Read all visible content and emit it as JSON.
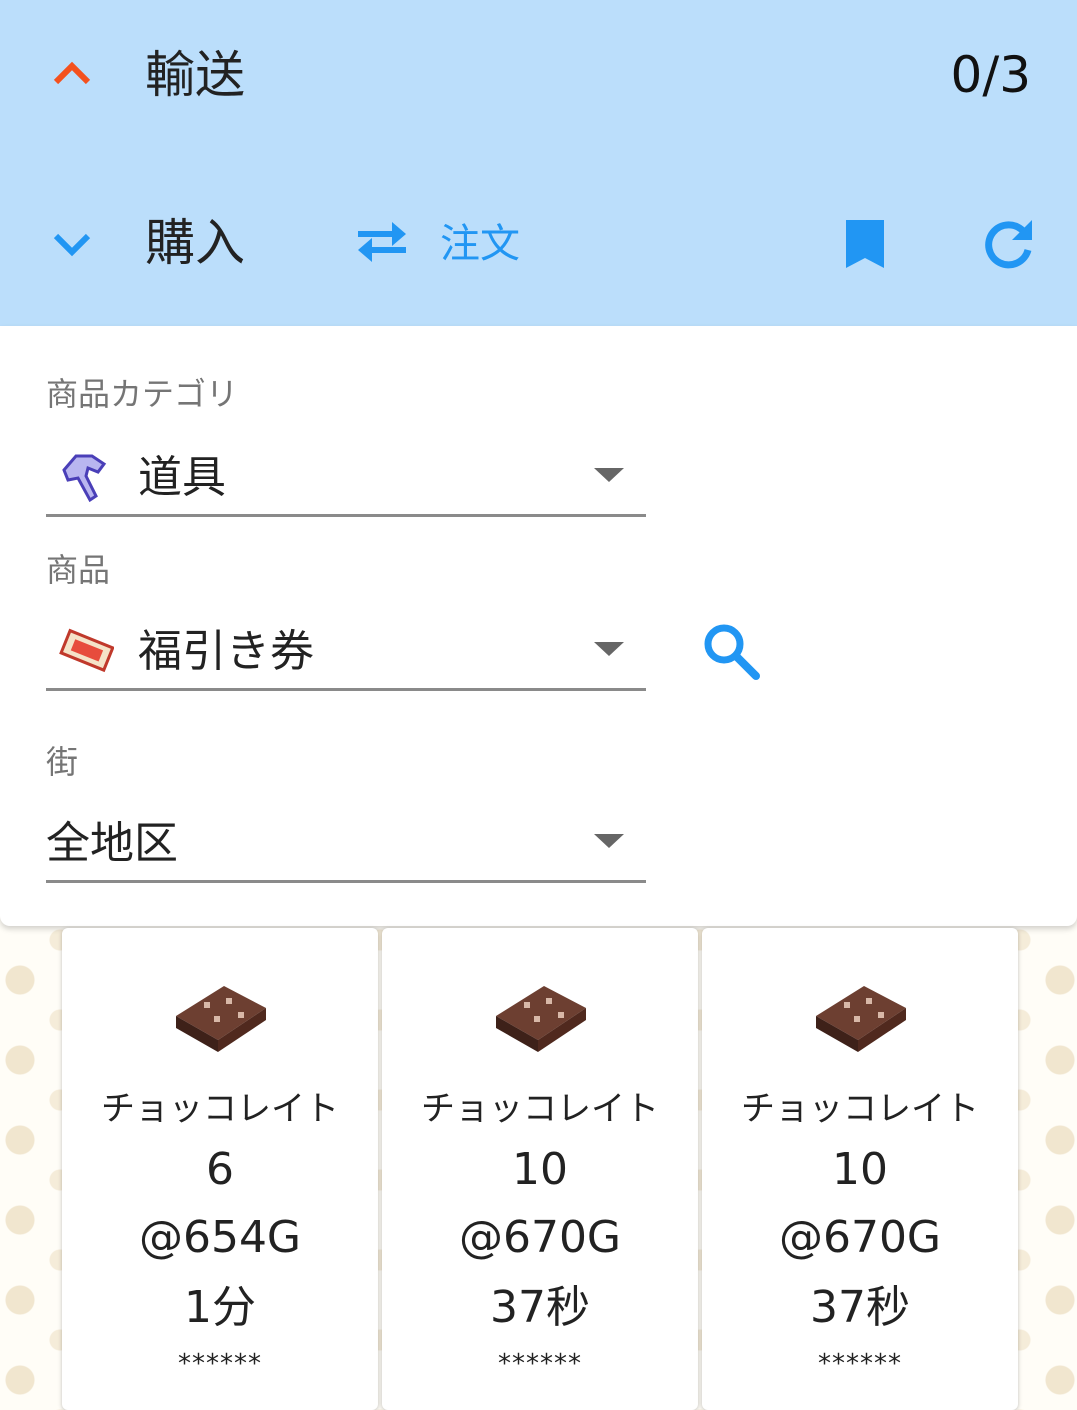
{
  "header": {
    "transport_label": "輸送",
    "transport_count": "0/3",
    "purchase_label": "購入",
    "order_label": "注文",
    "colors": {
      "background": "#bbdefb",
      "accent": "#2196f3",
      "chevron_up": "#f4511e"
    }
  },
  "filters": {
    "category": {
      "label": "商品カテゴリ",
      "value": "道具",
      "icon": "tool-icon"
    },
    "item": {
      "label": "商品",
      "value": "福引き券",
      "icon": "lottery-ticket-icon"
    },
    "town": {
      "label": "街",
      "value": "全地区"
    }
  },
  "listings": [
    {
      "name": "チョッコレイト",
      "quantity": "6",
      "price": "@654G",
      "time": "1分",
      "stars": "******",
      "icon": "chocolate-icon"
    },
    {
      "name": "チョッコレイト",
      "quantity": "10",
      "price": "@670G",
      "time": "37秒",
      "stars": "******",
      "icon": "chocolate-icon"
    },
    {
      "name": "チョッコレイト",
      "quantity": "10",
      "price": "@670G",
      "time": "37秒",
      "stars": "******",
      "icon": "chocolate-icon"
    }
  ]
}
